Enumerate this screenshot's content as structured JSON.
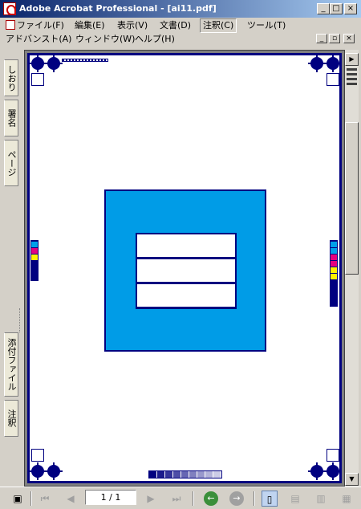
{
  "window": {
    "title": "Adobe Acrobat Professional - [ai11.pdf]",
    "minimize": "_",
    "maximize": "□",
    "close": "×"
  },
  "menu": {
    "row1": [
      "ファイル(F)",
      "編集(E)",
      "表示(V)",
      "文書(D)",
      "注釈(C)",
      "ツール(T)"
    ],
    "row2": [
      "アドバンスト(A)",
      "ウィンドウ(W)",
      "ヘルプ(H)"
    ],
    "active": "注釈(C)"
  },
  "nav_tabs": {
    "bookmarks": "しおり",
    "signatures": "署名",
    "pages": "ページ",
    "attachments": "添付ファイル",
    "comments": "注釈"
  },
  "status": {
    "page_display": "1 / 1"
  },
  "icons": [
    "adobe-pdf-icon",
    "first-page-icon",
    "prev-page-icon",
    "next-page-icon",
    "last-page-icon",
    "go-back-icon",
    "go-forward-icon",
    "single-page-icon",
    "continuous-icon",
    "facing-icon"
  ],
  "colors": {
    "titlebar_start": "#0a246a",
    "titlebar_end": "#a6caf0",
    "page_border": "#000080",
    "artwork_blue": "#009ce7",
    "chrome": "#d4d0c8",
    "nav_green": "#3a8f3a"
  },
  "swatches_left": [
    "#00a0e9",
    "#e4007f",
    "#fff100",
    "#000080",
    "#000080",
    "#000080"
  ],
  "swatches_right": [
    "#00a0e9",
    "#00a0e9",
    "#e4007f",
    "#e4007f",
    "#fff100",
    "#fff100",
    "#000080",
    "#000080",
    "#000080",
    "#000080"
  ]
}
